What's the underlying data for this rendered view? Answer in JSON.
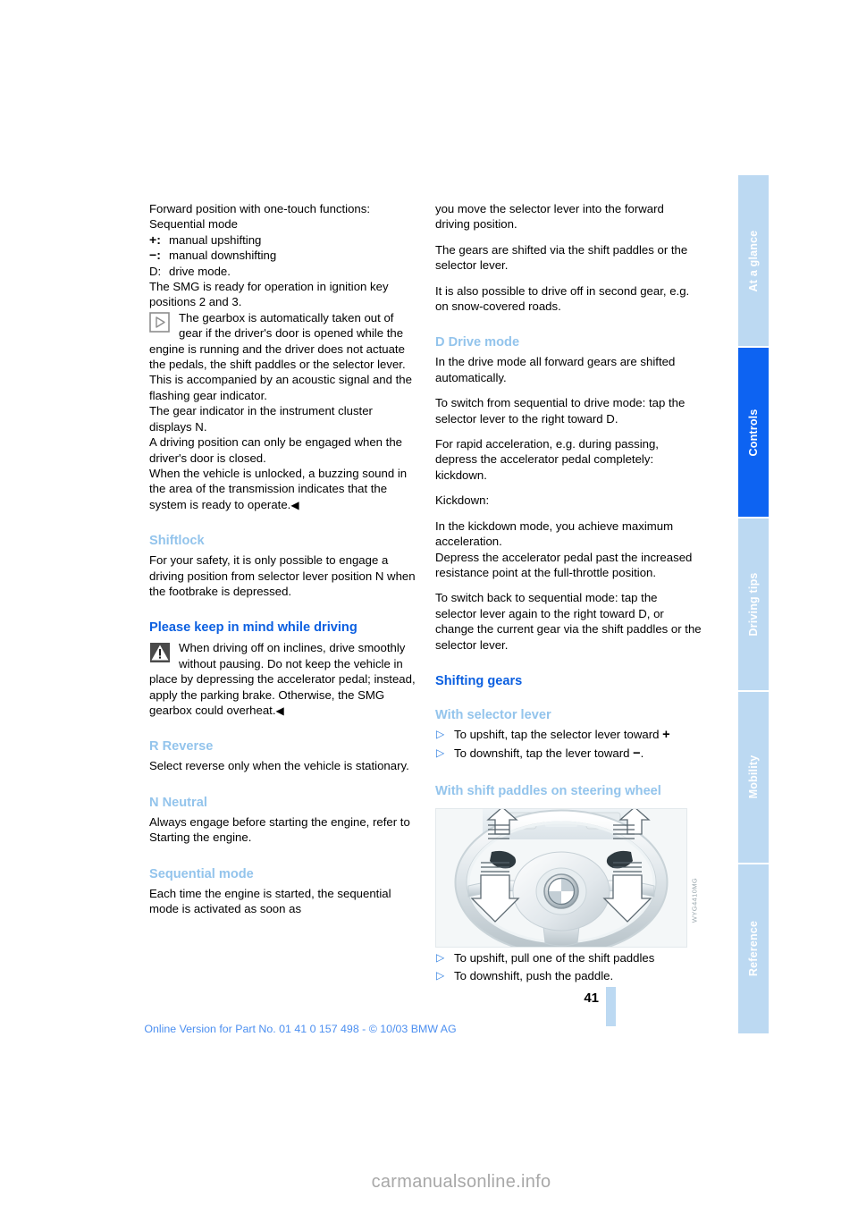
{
  "document": {
    "page_number": "41",
    "footer_note": "Online Version for Part No. 01 41 0 157 498 - © 10/03 BMW AG",
    "watermark": "carmanualsonline.info"
  },
  "nav_tabs": [
    {
      "label": "At a glance",
      "active": false
    },
    {
      "label": "Controls",
      "active": true
    },
    {
      "label": "Driving tips",
      "active": false
    },
    {
      "label": "Mobility",
      "active": false
    },
    {
      "label": "Reference",
      "active": false
    }
  ],
  "colors": {
    "heading_main": "#0b5fe0",
    "heading_sub": "#93c4ec",
    "tab_active": "#0d63f2",
    "tab_inactive": "#bcd9f2",
    "footer_text": "#4c8ff0",
    "bullet": "#2f7fe0"
  },
  "left_column": {
    "intro_line_1": "Forward position with one-touch functions:",
    "intro_line_2": "Sequential mode",
    "definitions": [
      {
        "symbol": "+",
        "separator": ":",
        "text": "manual upshifting"
      },
      {
        "symbol": "−",
        "separator": ":",
        "text": "manual downshifting"
      },
      {
        "symbol": "D",
        "separator": ":",
        "text": "drive mode."
      }
    ],
    "ready_para": "The SMG is ready for operation in ignition key positions 2 and 3.",
    "note": {
      "icon": "note-triangle-icon",
      "text": "The gearbox is automatically taken out of gear if the driver's door is opened while the engine is running and the driver does not actuate the pedals, the shift paddles or the selector lever.",
      "para2": "This is accompanied by an acoustic signal and the flashing gear indicator.",
      "para3": "The gear indicator in the instrument cluster displays N.",
      "para4": "A driving position can only be engaged when the driver's door is closed.",
      "para5": "When the vehicle is unlocked, a buzzing sound in the area of the transmission indicates that the system is ready to operate.",
      "endmark": "◀"
    },
    "shiftlock": {
      "heading": "Shiftlock",
      "body": "For your safety, it is only possible to engage a driving position from selector lever position N when the footbrake is depressed."
    },
    "keep_in_mind": {
      "heading": "Please keep in mind while driving",
      "icon": "warning-triangle-icon",
      "body": "When driving off on inclines, drive smoothly without pausing. Do not keep the vehicle in place by depressing the accelerator pedal; instead, apply the parking brake. Otherwise, the SMG gearbox could overheat.",
      "endmark": "◀"
    },
    "reverse": {
      "heading": "R  Reverse",
      "body": "Select reverse only when the vehicle is stationary."
    },
    "neutral": {
      "heading": "N  Neutral",
      "body": "Always engage before starting the engine, refer to Starting the engine."
    },
    "sequential": {
      "heading": "Sequential mode",
      "body": "Each time the engine is started, the sequential mode is activated as soon as"
    }
  },
  "right_column": {
    "continuation": "you move the selector lever into the forward driving position.",
    "para_shifted": "The gears are shifted via the shift paddles or the selector lever.",
    "para_second_gear": "It is also possible to drive off in second gear, e.g. on snow-covered roads.",
    "drive_mode": {
      "heading": "D Drive mode",
      "para1": "In the drive mode all forward gears are shifted automatically.",
      "para2": "To switch from sequential to drive mode: tap the selector lever to the right toward D.",
      "para3": "For rapid acceleration, e.g. during passing, depress the accelerator pedal completely: kickdown.",
      "para4": "Kickdown:",
      "para5": "In the kickdown mode, you achieve maximum acceleration.",
      "para6": "Depress the accelerator pedal past the increased resistance point at the full-throttle position.",
      "para7": "To switch back to sequential mode: tap the selector lever again to the right toward D, or change the current gear via the shift paddles or the selector lever."
    },
    "shifting_gears": {
      "heading": "Shifting gears",
      "selector_lever": {
        "heading": "With selector lever",
        "bullets": [
          {
            "text_before": "To upshift, tap the selector lever toward ",
            "symbol": "+"
          },
          {
            "text_before": "To downshift, tap the lever toward ",
            "symbol": "−",
            "text_after": "."
          }
        ]
      },
      "shift_paddles": {
        "heading": "With shift paddles on steering wheel",
        "figure": {
          "name": "steering-wheel-shift-paddles-illustration",
          "code": "WYG4410MG"
        },
        "bullets": [
          "To upshift, pull one of the shift paddles",
          "To downshift, push the paddle."
        ]
      }
    }
  }
}
